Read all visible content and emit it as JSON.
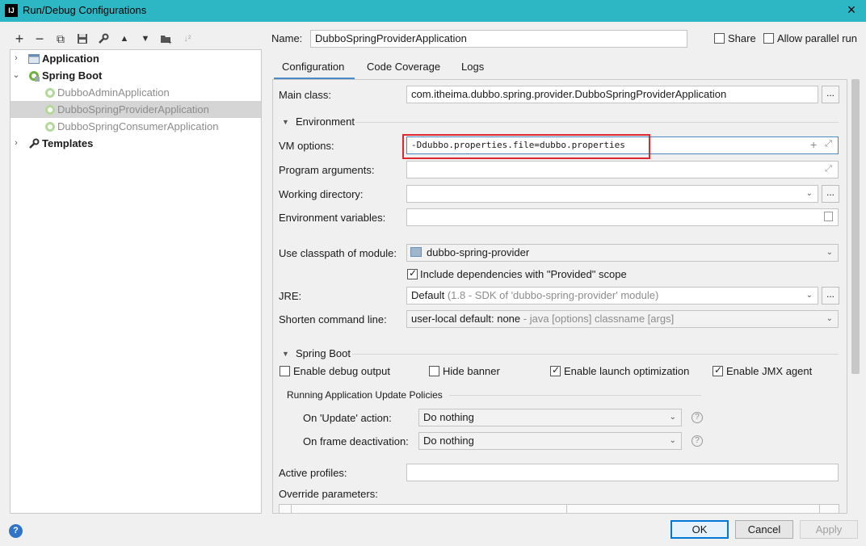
{
  "window": {
    "icon": "IJ",
    "title": "Run/Debug Configurations",
    "close_icon": "×"
  },
  "toolbar": {
    "add": "+",
    "remove": "−",
    "copy": "⧉",
    "save": "💾",
    "edit": "🔧",
    "up": "▲",
    "down": "▼",
    "folder": "📁",
    "sort": "↓²"
  },
  "tree": {
    "items": [
      {
        "label": "Application",
        "arrow": "›"
      },
      {
        "label": "Spring Boot",
        "arrow": "⌄"
      },
      {
        "label": "DubboAdminApplication"
      },
      {
        "label": "DubboSpringProviderApplication"
      },
      {
        "label": "DubboSpringConsumerApplication"
      },
      {
        "label": "Templates",
        "arrow": "›"
      }
    ]
  },
  "header": {
    "name_label": "Name:",
    "name_value": "DubboSpringProviderApplication",
    "share_label": "Share",
    "allow_parallel_label": "Allow parallel run"
  },
  "tabs": [
    "Configuration",
    "Code Coverage",
    "Logs"
  ],
  "config": {
    "main_class_label": "Main class:",
    "main_class_value": "com.itheima.dubbo.spring.provider.DubboSpringProviderApplication",
    "environment_title": "Environment",
    "vm_options_label": "VM options:",
    "vm_options_value": "-Ddubbo.properties.file=dubbo.properties",
    "program_args_label": "Program arguments:",
    "working_dir_label": "Working directory:",
    "env_vars_label": "Environment variables:",
    "classpath_label": "Use classpath of module:",
    "classpath_value": "dubbo-spring-provider",
    "include_deps_label": "Include dependencies with \"Provided\" scope",
    "jre_label": "JRE:",
    "jre_value": "Default",
    "jre_hint": "(1.8 - SDK of 'dubbo-spring-provider' module)",
    "shorten_label": "Shorten command line:",
    "shorten_value": "user-local default: none",
    "shorten_hint": "- java [options] classname [args]",
    "spring_boot_title": "Spring Boot",
    "enable_debug_label": "Enable debug output",
    "hide_banner_label": "Hide banner",
    "launch_opt_label": "Enable launch optimization",
    "jmx_label": "Enable JMX agent",
    "update_policies_title": "Running Application Update Policies",
    "on_update_label": "On 'Update' action:",
    "on_update_value": "Do nothing",
    "on_frame_label": "On frame deactivation:",
    "on_frame_value": "Do nothing",
    "active_profiles_label": "Active profiles:",
    "override_params_label": "Override parameters:"
  },
  "buttons": {
    "ok": "OK",
    "cancel": "Cancel",
    "apply": "Apply",
    "help": "?"
  },
  "colors": {
    "titlebar": "#2db7c4",
    "highlight_box": "#e0262e",
    "selection": "#d5d5d5"
  }
}
